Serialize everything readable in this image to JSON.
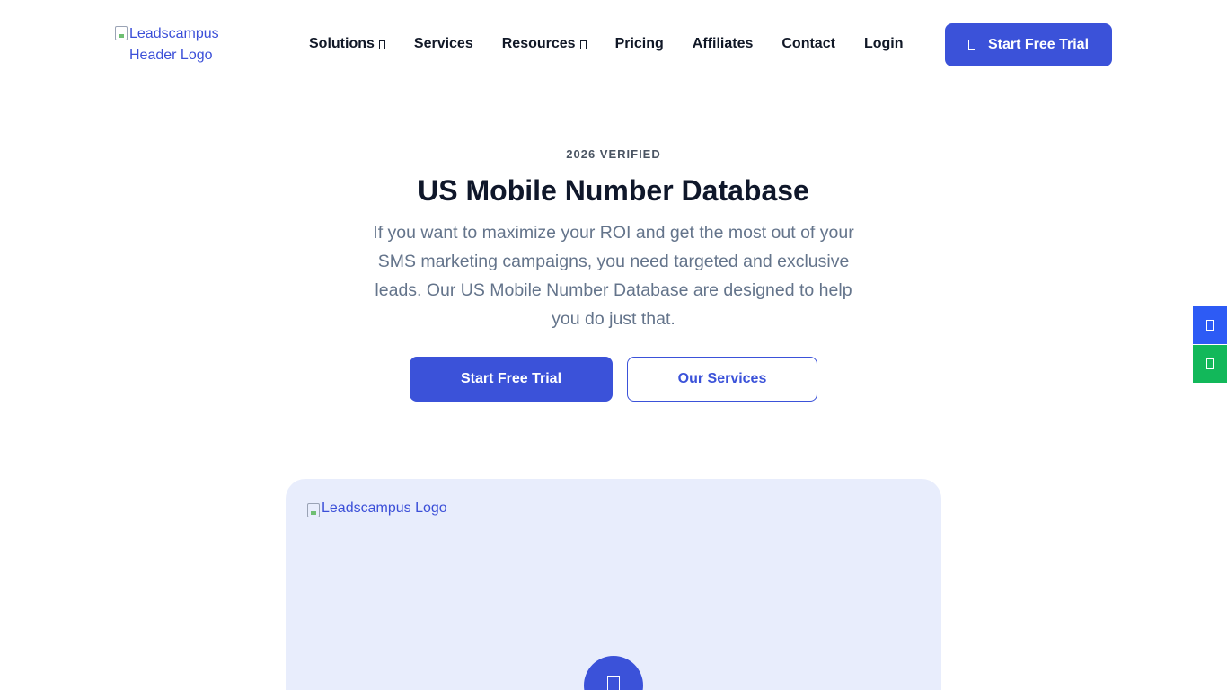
{
  "header": {
    "logo_alt": "Leadscampus Header Logo",
    "nav": [
      {
        "label": "Solutions",
        "has_dropdown": true
      },
      {
        "label": "Services",
        "has_dropdown": false
      },
      {
        "label": "Resources",
        "has_dropdown": true
      },
      {
        "label": "Pricing",
        "has_dropdown": false
      },
      {
        "label": "Affiliates",
        "has_dropdown": false
      },
      {
        "label": "Contact",
        "has_dropdown": false
      },
      {
        "label": "Login",
        "has_dropdown": false
      }
    ],
    "cta_label": "Start Free Trial"
  },
  "hero": {
    "eyebrow": "2026 VERIFIED",
    "title": "US Mobile Number Database",
    "description": "If you want to maximize your ROI and get the most out of your SMS marketing campaigns, you need targeted and exclusive leads. Our US Mobile Number Database are designed to help you do just that.",
    "primary_button": "Start Free Trial",
    "secondary_button": "Our Services"
  },
  "media_card": {
    "logo_alt": "Leadscampus Logo"
  },
  "colors": {
    "accent": "#3b52d9",
    "side_blue": "#2d5bf5",
    "side_green": "#12b85a",
    "card_bg": "#e8edfc"
  },
  "icons": {
    "nav_caret": "chevron-down-icon",
    "cta_icon": "rocket-icon",
    "side_top": "phone-icon",
    "side_bottom": "whatsapp-icon",
    "card_center": "play-icon"
  }
}
